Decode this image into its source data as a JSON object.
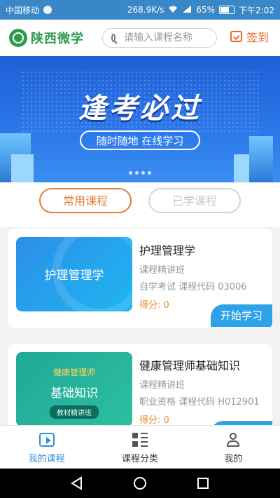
{
  "status_bar": {
    "carrier": "中国移动",
    "speed": "268.9K/s",
    "battery": "65%",
    "time": "下午2:02"
  },
  "header": {
    "logo_text": "陕西微学",
    "search_placeholder": "请输入课程名称",
    "signin_label": "签到"
  },
  "banner": {
    "title": "逢考必过",
    "subtitle": "随时随地 在线学习"
  },
  "tabs": [
    {
      "label": "常用课程",
      "active": true
    },
    {
      "label": "已学课程",
      "active": false
    }
  ],
  "courses": [
    {
      "thumb_title": "护理管理学",
      "name": "护理管理学",
      "type": "课程精讲班",
      "meta": "自学考试  课程代码 03006",
      "score": "得分: 0",
      "button": "开始学习"
    },
    {
      "thumb_small": "健康管理师",
      "thumb_title": "基础知识",
      "thumb_tag": "教材精讲班",
      "name": "健康管理师基础知识",
      "type": "课程精讲班",
      "meta": "职业资格  课程代码 H012901",
      "score": "得分: 0"
    }
  ],
  "bottom_nav": [
    {
      "label": "我的课程",
      "icon": "play-icon",
      "active": true
    },
    {
      "label": "课程分类",
      "icon": "category-icon",
      "active": false
    },
    {
      "label": "我的",
      "icon": "user-icon",
      "active": false
    }
  ],
  "colors": {
    "status_bar": "#3a87c8",
    "brand_green": "#2f9a50",
    "accent_orange": "#e57a35",
    "accent_blue": "#2d8fe0"
  }
}
